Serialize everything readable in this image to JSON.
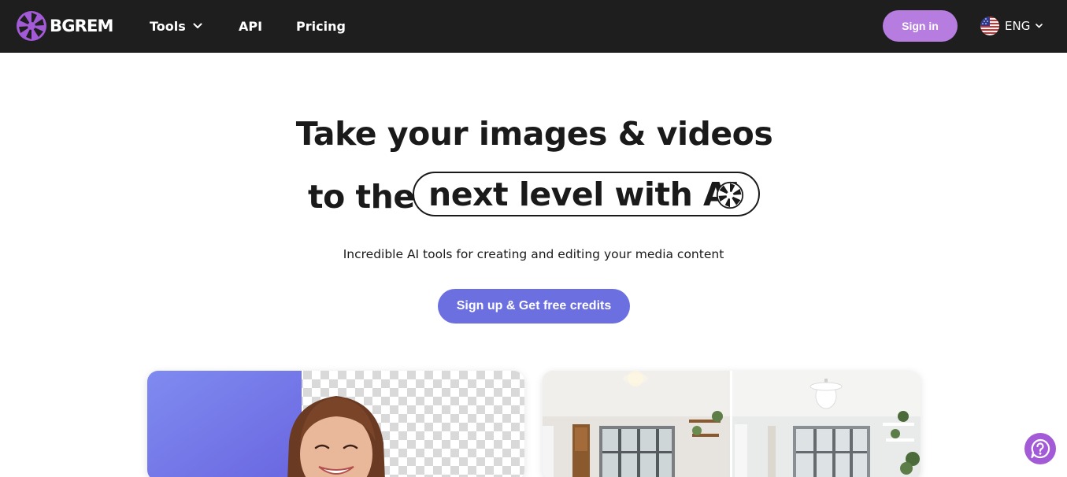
{
  "brand": {
    "name": "BGREM",
    "logo_icon": "aperture-icon"
  },
  "nav": {
    "items": [
      {
        "label": "Tools",
        "has_dropdown": true
      },
      {
        "label": "API"
      },
      {
        "label": "Pricing"
      }
    ],
    "signin_label": "Sign in",
    "language": {
      "label": "ENG",
      "flag_icon": "us-flag-icon"
    }
  },
  "hero": {
    "line1": "Take your images & videos",
    "line2_prefix": "to the",
    "line2_highlight": "next level with AI",
    "subtitle": "Incredible AI tools for creating and editing your media content",
    "cta_label": "Sign up & Get free credits"
  },
  "cards": [
    {
      "name": "background-removal-demo",
      "icon": "portrait-image"
    },
    {
      "name": "interior-redesign-demo",
      "icon": "room-image"
    }
  ],
  "help": {
    "icon": "help-chat-icon"
  },
  "colors": {
    "navbar_bg": "#1e1e1e",
    "signin_bg": "#b67ce0",
    "cta_bg": "#6b6fe0",
    "logo_purple": "#a25ad6",
    "help_bg": "#a25ad6"
  }
}
